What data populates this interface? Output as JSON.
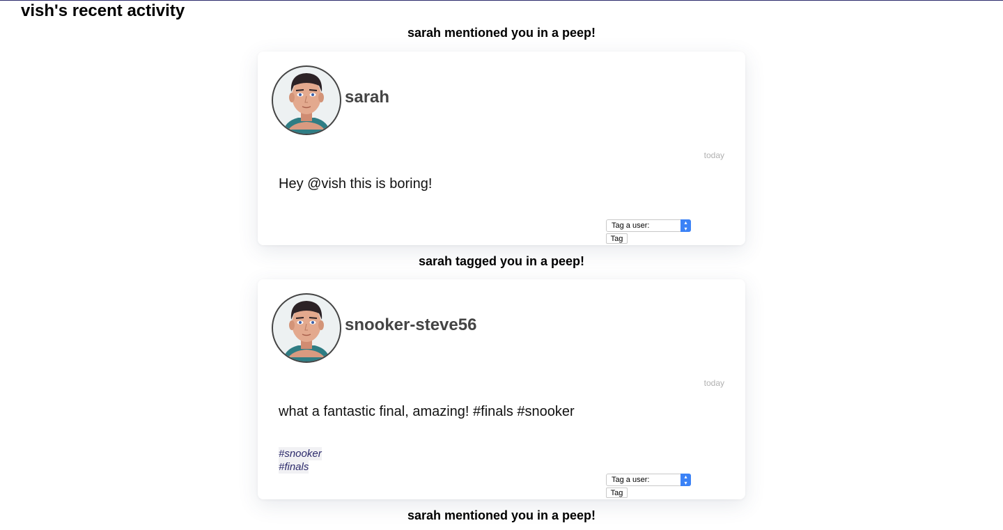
{
  "page": {
    "title": "vish's recent activity"
  },
  "activities": [
    {
      "heading": "sarah mentioned you in a peep!",
      "peep": {
        "username": "sarah",
        "time": "today",
        "content": "Hey @vish this is boring!",
        "tags": []
      }
    },
    {
      "heading": "sarah tagged you in a peep!",
      "peep": {
        "username": "snooker-steve56",
        "time": "today",
        "content": "what a fantastic final, amazing! #finals #snooker",
        "tags": [
          "#snooker",
          "#finals"
        ]
      }
    },
    {
      "heading": "sarah mentioned you in a peep!"
    }
  ],
  "tag_form": {
    "select_value": "Tag a user:",
    "button_label": "Tag"
  },
  "colors": {
    "accent": "#3b82f6",
    "hashtag": "#2c2a6b",
    "username": "#444444",
    "timestamp": "#b0b0b0"
  },
  "icons": {
    "avatar": "cartoon-man-avatar-icon",
    "select_arrows": "up-down-chevron-icon"
  }
}
